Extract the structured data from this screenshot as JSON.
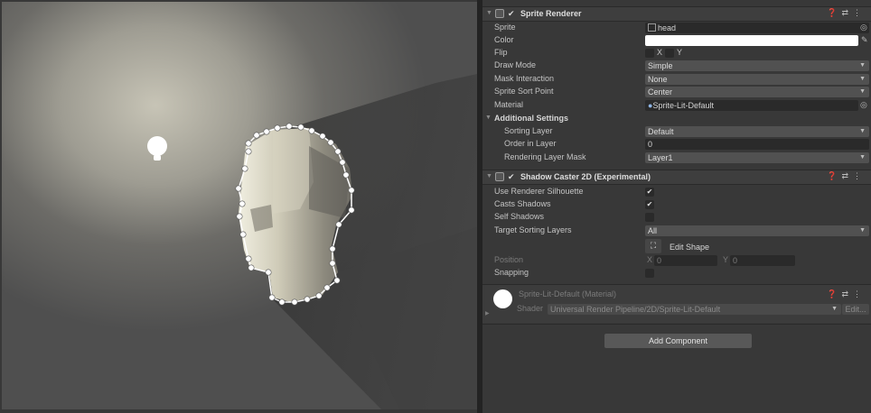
{
  "scene": {
    "light_icon": "light-bulb-icon"
  },
  "sprite_renderer": {
    "title": "Sprite Renderer",
    "sprite_label": "Sprite",
    "sprite_value": "head",
    "color_label": "Color",
    "color_value": "#ffffff",
    "flip_label": "Flip",
    "flip_x": "X",
    "flip_y": "Y",
    "draw_mode_label": "Draw Mode",
    "draw_mode_value": "Simple",
    "mask_label": "Mask Interaction",
    "mask_value": "None",
    "sort_point_label": "Sprite Sort Point",
    "sort_point_value": "Center",
    "material_label": "Material",
    "material_value": "Sprite-Lit-Default",
    "additional_label": "Additional Settings",
    "sorting_layer_label": "Sorting Layer",
    "sorting_layer_value": "Default",
    "order_label": "Order in Layer",
    "order_value": "0",
    "rlm_label": "Rendering Layer Mask",
    "rlm_value": "Layer1"
  },
  "shadow_caster": {
    "title": "Shadow Caster 2D (Experimental)",
    "use_silhouette_label": "Use Renderer Silhouette",
    "use_silhouette": true,
    "casts_label": "Casts Shadows",
    "casts": true,
    "self_label": "Self Shadows",
    "self": false,
    "target_label": "Target Sorting Layers",
    "target_value": "All",
    "edit_shape_label": "Edit Shape",
    "position_label": "Position",
    "pos_x_label": "X",
    "pos_x": "0",
    "pos_y_label": "Y",
    "pos_y": "0",
    "snapping_label": "Snapping"
  },
  "material_section": {
    "name": "Sprite-Lit-Default (Material)",
    "shader_label": "Shader",
    "shader_value": "Universal Render Pipeline/2D/Sprite-Lit-Default",
    "edit_label": "Edit..."
  },
  "add_component_label": "Add Component"
}
